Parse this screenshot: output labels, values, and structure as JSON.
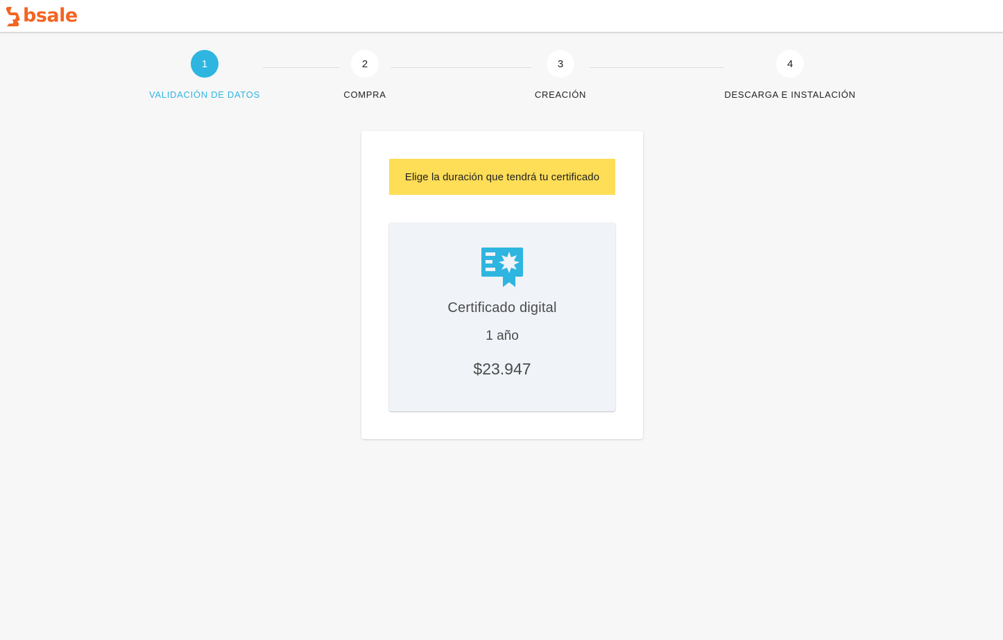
{
  "brand": {
    "name": "bsale",
    "color": "#f26522"
  },
  "theme": {
    "accent": "#2eb5e0",
    "notice_bg": "#fedd57"
  },
  "stepper": {
    "steps": [
      {
        "number": "1",
        "label": "VALIDACIÓN DE DATOS",
        "active": true
      },
      {
        "number": "2",
        "label": "COMPRA",
        "active": false
      },
      {
        "number": "3",
        "label": "CREACIÓN",
        "active": false
      },
      {
        "number": "4",
        "label": "DESCARGA E INSTALACIÓN",
        "active": false
      }
    ]
  },
  "main": {
    "notice": "Elige la duración que tendrá tu certificado",
    "option": {
      "icon": "certificate-icon",
      "title": "Certificado digital",
      "duration": "1 año",
      "price": "$23.947"
    }
  }
}
